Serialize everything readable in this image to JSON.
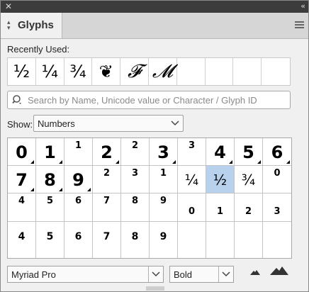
{
  "titlebar": {
    "close_icon": "close-icon",
    "collapse_icon": "collapse-arrows-icon"
  },
  "tab": {
    "label": "Glyphs",
    "icon": "up-down-arrows-icon"
  },
  "panel_menu_icon": "hamburger-menu-icon",
  "recently_used": {
    "label": "Recently Used:",
    "glyphs": [
      "½",
      "¼",
      "¾",
      "❦",
      "𝓕",
      "𝓜",
      "",
      "",
      "",
      ""
    ]
  },
  "search": {
    "placeholder": "Search by Name, Unicode value or Character / Glyph ID",
    "value": ""
  },
  "show": {
    "label": "Show:",
    "value": "Numbers"
  },
  "glyph_grid": {
    "rows": [
      [
        {
          "g": "0",
          "s": "big",
          "alt": true
        },
        {
          "g": "1",
          "s": "big",
          "alt": true
        },
        {
          "g": "1",
          "s": "sup"
        },
        {
          "g": "2",
          "s": "big",
          "alt": true
        },
        {
          "g": "2",
          "s": "sup"
        },
        {
          "g": "3",
          "s": "big",
          "alt": true
        },
        {
          "g": "3",
          "s": "sup"
        },
        {
          "g": "4",
          "s": "big",
          "alt": true
        },
        {
          "g": "5",
          "s": "big",
          "alt": true
        },
        {
          "g": "6",
          "s": "big",
          "alt": true
        }
      ],
      [
        {
          "g": "7",
          "s": "big",
          "alt": true
        },
        {
          "g": "8",
          "s": "big",
          "alt": true
        },
        {
          "g": "9",
          "s": "big",
          "alt": true
        },
        {
          "g": "2",
          "s": "sup"
        },
        {
          "g": "3",
          "s": "sup"
        },
        {
          "g": "1",
          "s": "sup"
        },
        {
          "g": "¼",
          "s": "frac"
        },
        {
          "g": "½",
          "s": "frac",
          "selected": true
        },
        {
          "g": "¾",
          "s": "frac"
        },
        {
          "g": "0",
          "s": "sup"
        }
      ],
      [
        {
          "g": "4",
          "s": "sup"
        },
        {
          "g": "5",
          "s": "sup"
        },
        {
          "g": "6",
          "s": "sup"
        },
        {
          "g": "7",
          "s": "sup"
        },
        {
          "g": "8",
          "s": "sup"
        },
        {
          "g": "9",
          "s": "sup"
        },
        {
          "g": "0",
          "s": "inf"
        },
        {
          "g": "1",
          "s": "inf"
        },
        {
          "g": "2",
          "s": "inf"
        },
        {
          "g": "3",
          "s": "inf"
        }
      ],
      [
        {
          "g": "4",
          "s": "mid"
        },
        {
          "g": "5",
          "s": "mid"
        },
        {
          "g": "6",
          "s": "mid"
        },
        {
          "g": "7",
          "s": "mid"
        },
        {
          "g": "8",
          "s": "mid"
        },
        {
          "g": "9",
          "s": "mid"
        },
        {
          "g": "",
          "s": "mid"
        },
        {
          "g": "",
          "s": "mid"
        },
        {
          "g": "",
          "s": "mid"
        },
        {
          "g": "",
          "s": "mid"
        }
      ]
    ]
  },
  "font_family": {
    "value": "Myriad Pro"
  },
  "font_style": {
    "value": "Bold"
  },
  "zoom": {
    "out_icon": "zoom-out-mountain-icon",
    "in_icon": "zoom-in-mountain-icon"
  },
  "colors": {
    "selected_cell": "#b8d2ee",
    "title_strip": "#3c3c3c"
  }
}
